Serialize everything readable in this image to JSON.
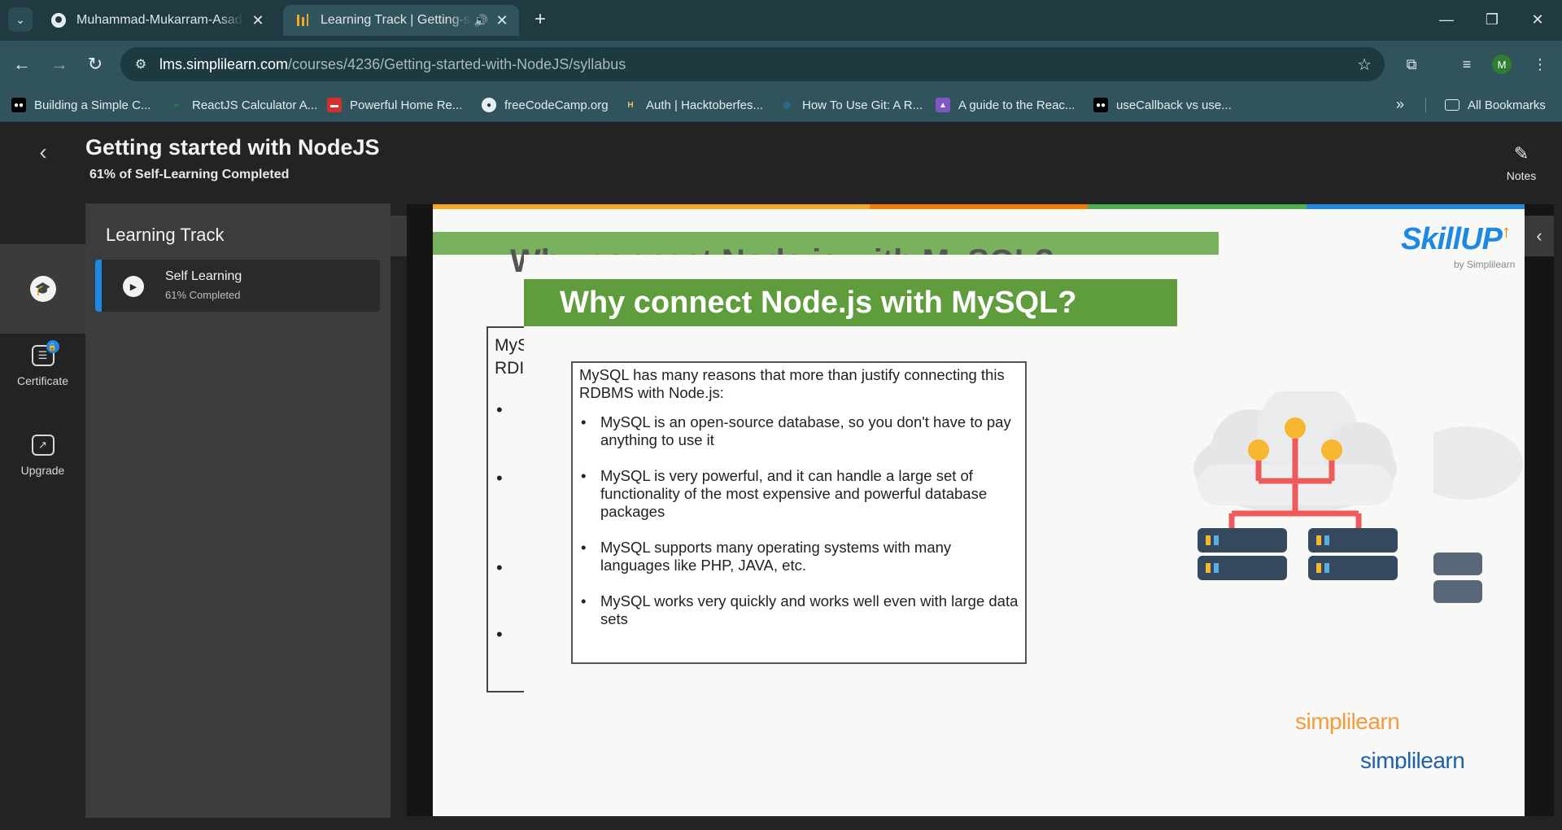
{
  "browser": {
    "tabs": [
      {
        "title": "Muhammad-Mukarram-Asad/N",
        "icon": "github-icon"
      },
      {
        "title": "Learning Track | Getting-sta",
        "icon": "simplilearn-icon",
        "audio": true
      }
    ],
    "url_host": "lms.simplilearn.com",
    "url_path": "/courses/4236/Getting-started-with-NodeJS/syllabus",
    "avatar_letter": "M",
    "bookmarks": [
      {
        "label": "Building a Simple C...",
        "icon": "medium-icon"
      },
      {
        "label": "ReactJS Calculator A...",
        "icon": "geeksforgeeks-icon"
      },
      {
        "label": "Powerful Home Re...",
        "icon": "bookmark-red-icon"
      },
      {
        "label": "freeCodeCamp.org",
        "icon": "github-icon"
      },
      {
        "label": "Auth | Hacktoberfes...",
        "icon": "hacktoberfest-icon"
      },
      {
        "label": "How To Use Git: A R...",
        "icon": "globe-blue-icon"
      },
      {
        "label": "A guide to the Reac...",
        "icon": "rocket-icon"
      },
      {
        "label": "useCallback vs use...",
        "icon": "medium-icon"
      }
    ],
    "all_bookmarks_label": "All Bookmarks"
  },
  "course": {
    "title": "Getting started with NodeJS",
    "progress_text": "61% of Self-Learning Completed",
    "notes_label": "Notes"
  },
  "rail": {
    "certificate_label": "Certificate",
    "upgrade_label": "Upgrade"
  },
  "track": {
    "heading": "Learning Track",
    "item_name": "Self Learning",
    "item_progress": "61% Completed"
  },
  "slide": {
    "ghost_title": "Why connect Node.js with MySQL?",
    "ghost_box_text": "MyS\nRDI",
    "title": "Why connect Node.js with MySQL?",
    "intro": "MySQL has many reasons that more than justify connecting this RDBMS with Node.js:",
    "bullets": [
      "MySQL is an open-source database, so you don't have to pay anything to use it",
      "MySQL is very powerful, and it can handle a large set of functionality of the most expensive and powerful database packages",
      "MySQL supports many operating systems with many languages like PHP, JAVA, etc.",
      "MySQL works very quickly and works well even with large data sets"
    ],
    "brand": "SkillUP",
    "brand_sub": "by Simplilearn",
    "footer_logo": "simplilearn",
    "colors": {
      "banner": "#5e9c3c",
      "brand_blue": "#1e88e5",
      "brand_orange": "#f57c00"
    }
  }
}
